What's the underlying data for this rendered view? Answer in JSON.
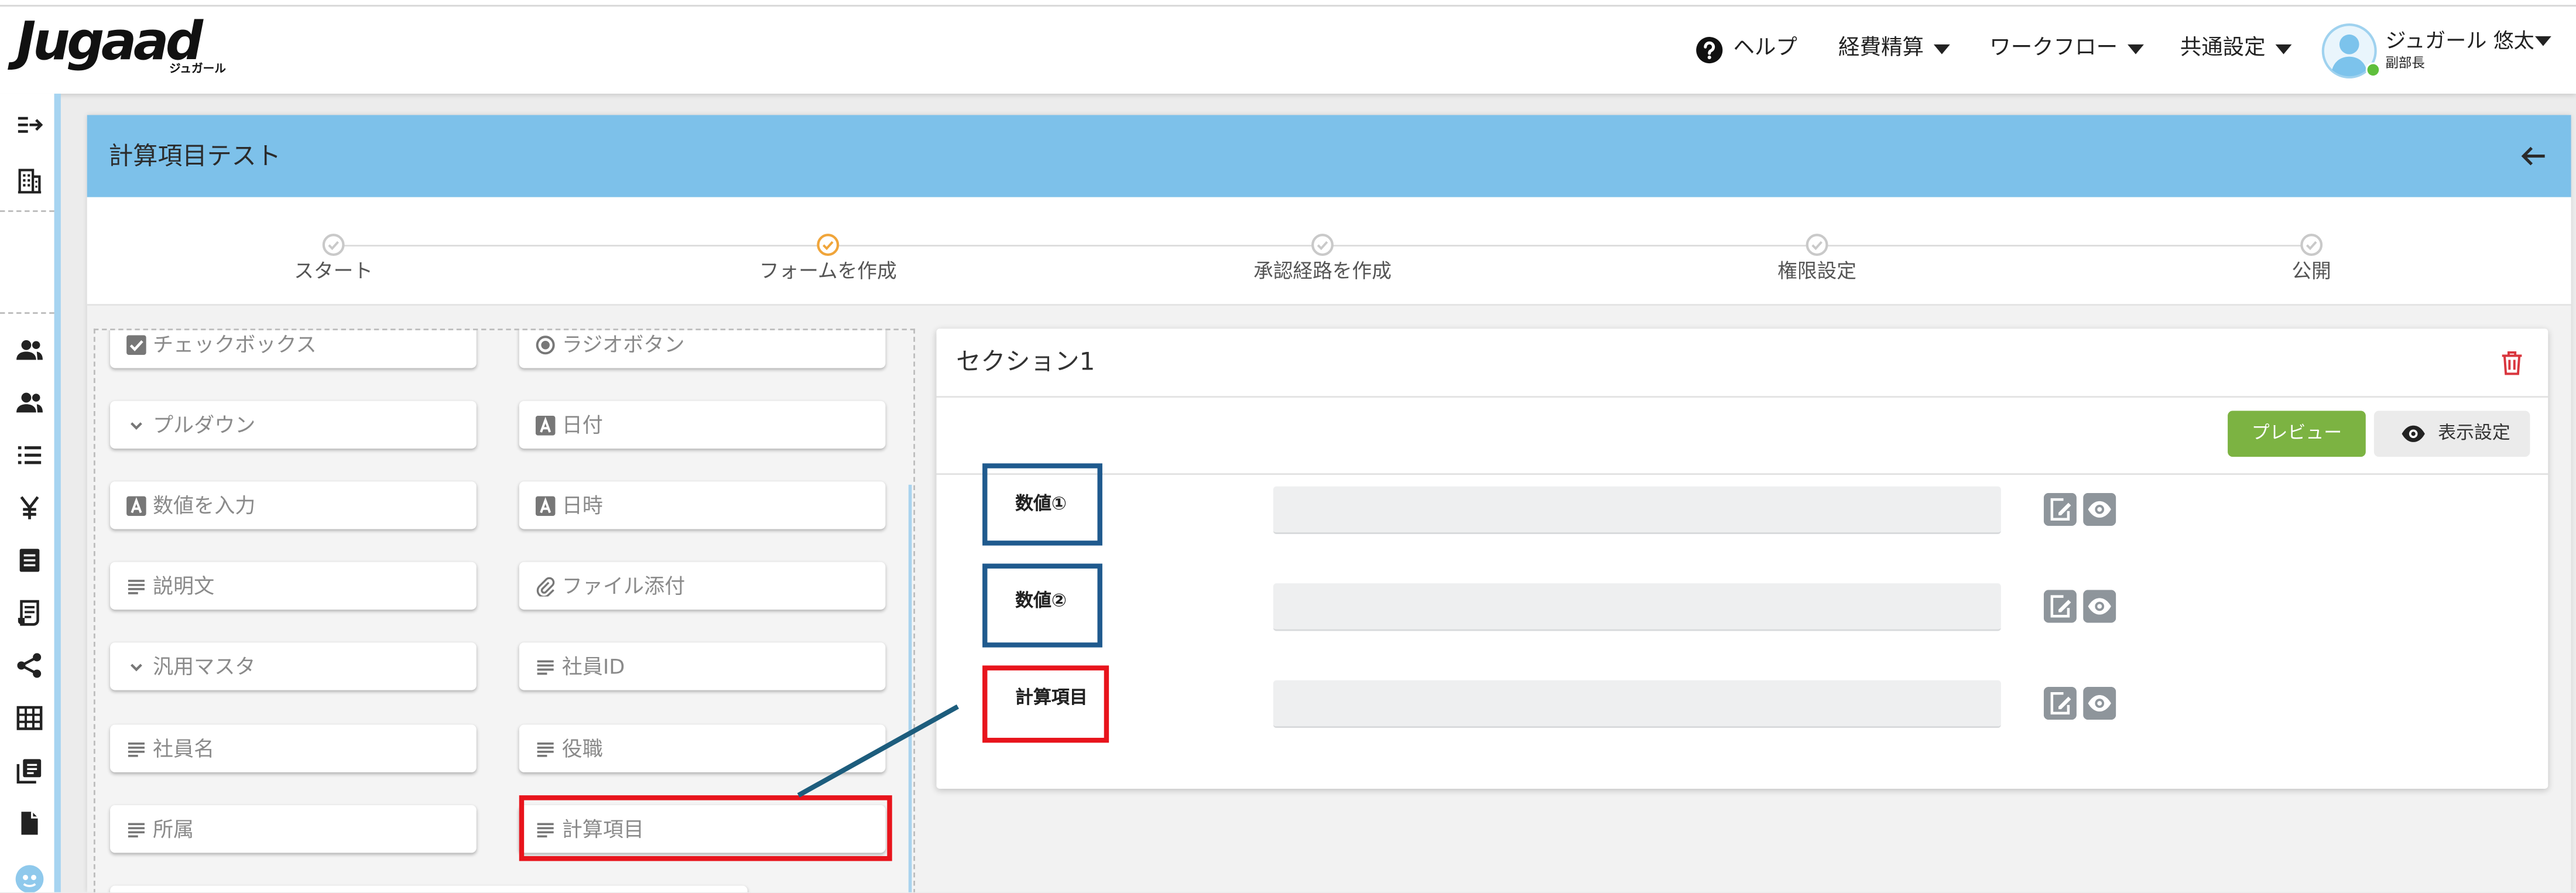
{
  "app": {
    "logo": "Jugaad",
    "logo_sub": "ジュガール"
  },
  "header": {
    "help_label": "ヘルプ",
    "menus": [
      {
        "label": "経費精算"
      },
      {
        "label": "ワークフロー"
      },
      {
        "label": "共通設定"
      }
    ],
    "user": {
      "name": "ジュガール 悠太",
      "role": "副部長"
    }
  },
  "sidebar": {
    "icons": [
      "collapse-menu-icon",
      "building-icon",
      "users-icon",
      "user-group-icon",
      "list-icon",
      "yen-icon",
      "document-icon",
      "receipt-icon",
      "share-icon",
      "table-icon",
      "copy-icon",
      "file-icon",
      "support-icon"
    ]
  },
  "page": {
    "title": "計算項目テスト"
  },
  "stepper": {
    "current_index": 1,
    "steps": [
      {
        "label": "スタート"
      },
      {
        "label": "フォームを作成"
      },
      {
        "label": "承認経路を作成"
      },
      {
        "label": "権限設定"
      },
      {
        "label": "公開"
      }
    ]
  },
  "palette": {
    "items": [
      {
        "label": "チェックボックス",
        "icon": "checkbox-icon"
      },
      {
        "label": "ラジオボタン",
        "icon": "radio-icon"
      },
      {
        "label": "プルダウン",
        "icon": "chevron-down-icon"
      },
      {
        "label": "日付",
        "icon": "text-a-icon"
      },
      {
        "label": "数値を入力",
        "icon": "text-a-icon"
      },
      {
        "label": "日時",
        "icon": "text-a-icon"
      },
      {
        "label": "説明文",
        "icon": "lines-icon"
      },
      {
        "label": "ファイル添付",
        "icon": "paperclip-icon"
      },
      {
        "label": "汎用マスタ",
        "icon": "chevron-down-icon"
      },
      {
        "label": "社員ID",
        "icon": "lines-icon"
      },
      {
        "label": "社員名",
        "icon": "lines-icon"
      },
      {
        "label": "役職",
        "icon": "lines-icon"
      },
      {
        "label": "所属",
        "icon": "lines-icon"
      },
      {
        "label": "計算項目",
        "icon": "lines-icon"
      }
    ]
  },
  "section": {
    "title": "セクション1",
    "preview_label": "プレビュー",
    "display_settings_label": "表示設定",
    "fields": [
      {
        "label": "数値①"
      },
      {
        "label": "数値②"
      },
      {
        "label": "計算項目"
      }
    ]
  },
  "colors": {
    "title_bar": "#7dc1ea",
    "accent_orange": "#f0a53a",
    "preview_green": "#7cb342",
    "delete_red": "#d9363e",
    "annotation_blue": "#1f5a8e",
    "annotation_red": "#e8141c"
  }
}
